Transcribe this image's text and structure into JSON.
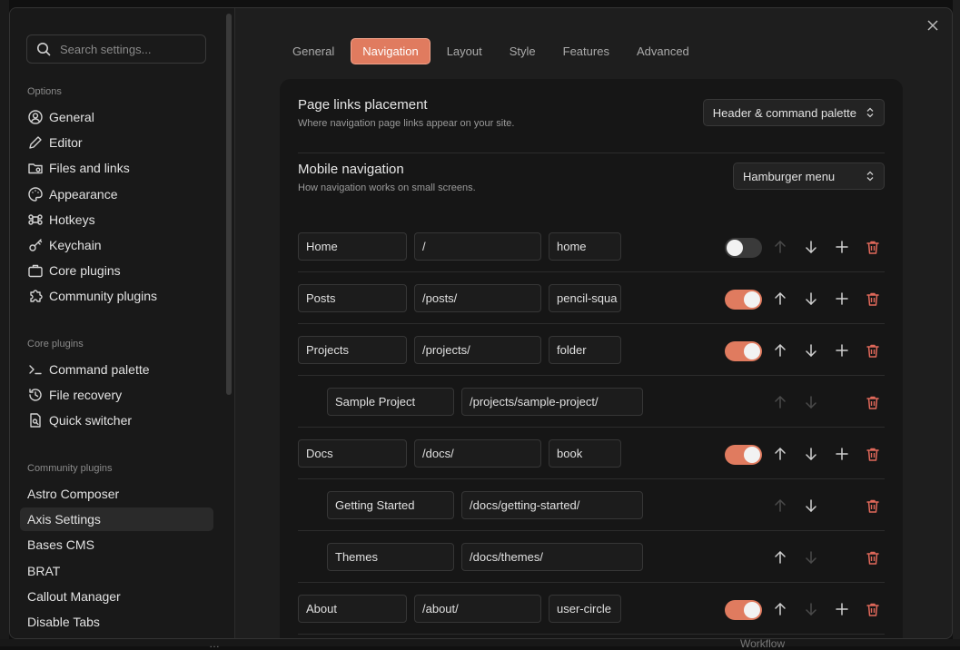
{
  "background": {
    "bottom_text_1": "…",
    "bottom_text_2": "Workflow"
  },
  "sidebar": {
    "search_placeholder": "Search settings...",
    "options_header": "Options",
    "options": [
      {
        "label": "General",
        "icon": "user-circle-icon"
      },
      {
        "label": "Editor",
        "icon": "pencil-icon"
      },
      {
        "label": "Files and links",
        "icon": "folder-cog-icon"
      },
      {
        "label": "Appearance",
        "icon": "palette-icon"
      },
      {
        "label": "Hotkeys",
        "icon": "command-icon"
      },
      {
        "label": "Keychain",
        "icon": "key-icon"
      },
      {
        "label": "Core plugins",
        "icon": "briefcase-icon"
      },
      {
        "label": "Community plugins",
        "icon": "puzzle-icon"
      }
    ],
    "core_header": "Core plugins",
    "core_plugins": [
      {
        "label": "Command palette",
        "icon": "terminal-icon"
      },
      {
        "label": "File recovery",
        "icon": "history-icon"
      },
      {
        "label": "Quick switcher",
        "icon": "file-search-icon"
      }
    ],
    "community_header": "Community plugins",
    "community_plugins": [
      {
        "label": "Astro Composer"
      },
      {
        "label": "Axis Settings",
        "active": true
      },
      {
        "label": "Bases CMS"
      },
      {
        "label": "BRAT"
      },
      {
        "label": "Callout Manager"
      },
      {
        "label": "Disable Tabs"
      }
    ]
  },
  "tabs": [
    "General",
    "Navigation",
    "Layout",
    "Style",
    "Features",
    "Advanced"
  ],
  "active_tab": "Navigation",
  "settings": {
    "page_links": {
      "name": "Page links placement",
      "desc": "Where navigation page links appear on your site.",
      "value": "Header & command palette"
    },
    "mobile_nav": {
      "name": "Mobile navigation",
      "desc": "How navigation works on small screens.",
      "value": "Hamburger menu"
    }
  },
  "nav_items": [
    {
      "title": "Home",
      "path": "/",
      "icon": "home",
      "enabled": false
    },
    {
      "title": "Posts",
      "path": "/posts/",
      "icon": "pencil-squa",
      "enabled": true
    },
    {
      "title": "Projects",
      "path": "/projects/",
      "icon": "folder",
      "enabled": true
    },
    {
      "title": "Sample Project",
      "path": "/projects/sample-project/",
      "child": true
    },
    {
      "title": "Docs",
      "path": "/docs/",
      "icon": "book",
      "enabled": true
    },
    {
      "title": "Getting Started",
      "path": "/docs/getting-started/",
      "child": true
    },
    {
      "title": "Themes",
      "path": "/docs/themes/",
      "child": true
    },
    {
      "title": "About",
      "path": "/about/",
      "icon": "user-circle",
      "enabled": true
    }
  ],
  "colors": {
    "accent": "#e07b5f",
    "delete": "#e0685a",
    "panel": "#161616"
  }
}
